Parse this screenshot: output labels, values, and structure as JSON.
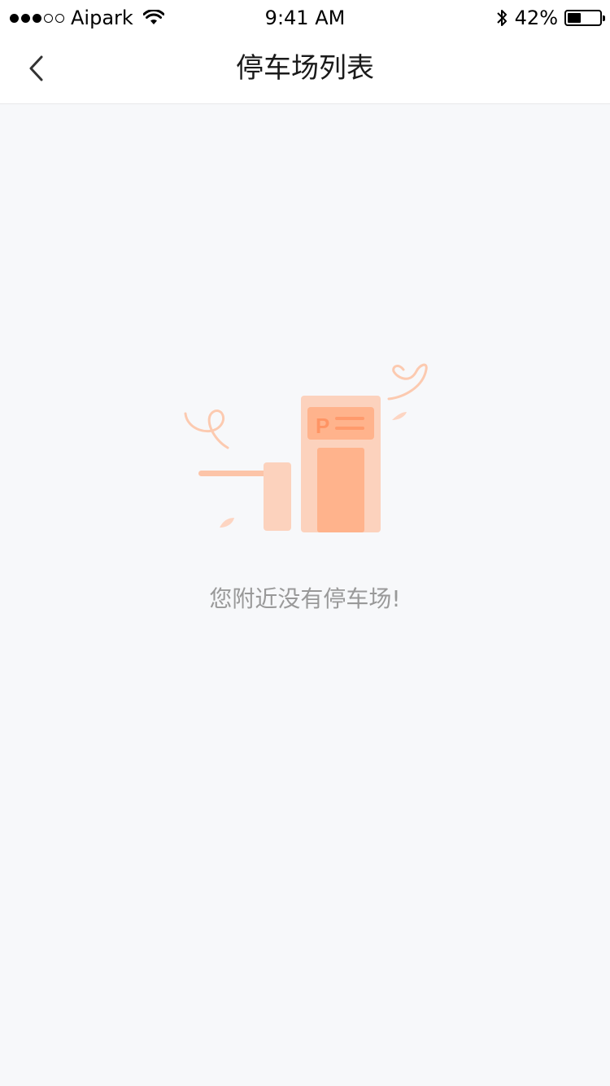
{
  "status_bar": {
    "carrier": "Aipark",
    "time": "9:41 AM",
    "battery_percent": "42%",
    "battery_level": 0.42,
    "signal_bars_filled": 3,
    "signal_bars_total": 5
  },
  "nav": {
    "title": "停车场列表",
    "back_icon": "chevron-left-icon"
  },
  "empty_state": {
    "message": "您附近没有停车场!",
    "illustration_icon": "parking-gate-illustration",
    "illustration_letter": "P",
    "accent_color": "#ffb38c"
  }
}
